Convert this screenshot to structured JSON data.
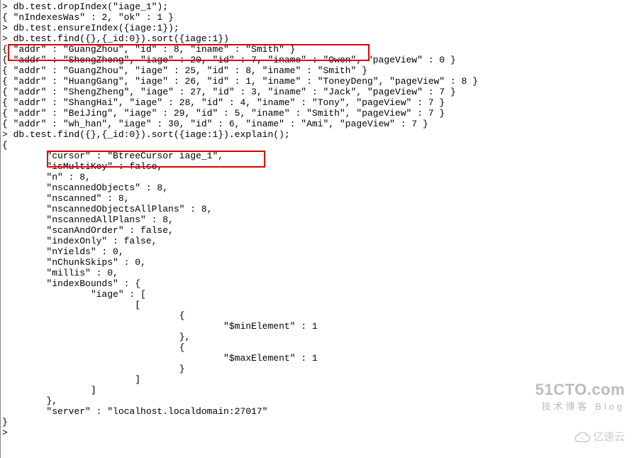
{
  "lines": {
    "l1": "> db.test.dropIndex(\"iage_1\");",
    "l2": "{ \"nIndexesWas\" : 2, \"ok\" : 1 }",
    "l3": "> db.test.ensureIndex({iage:1});",
    "l4": "> db.test.find({},{_id:0}).sort({iage:1})",
    "l5": "{ \"addr\" : \"GuangZhou\", \"id\" : 8, \"iname\" : \"Smith\" }",
    "l6": "{ \"addr\" : \"ShengZheng\", \"iage\" : 20, \"id\" : 7, \"iname\" : \"Owen\", \"pageView\" : 0 }",
    "l7": "{ \"addr\" : \"GuangZhou\", \"iage\" : 25, \"id\" : 8, \"iname\" : \"Smith\" }",
    "l8": "{ \"addr\" : \"HuangGang\", \"iage\" : 26, \"id\" : 1, \"iname\" : \"ToneyDeng\", \"pageView\" : 8 }",
    "l9": "{ \"addr\" : \"ShengZheng\", \"iage\" : 27, \"id\" : 3, \"iname\" : \"Jack\", \"pageView\" : 7 }",
    "l10": "{ \"addr\" : \"ShangHai\", \"iage\" : 28, \"id\" : 4, \"iname\" : \"Tony\", \"pageView\" : 7 }",
    "l11": "{ \"addr\" : \"BeiJing\", \"iage\" : 29, \"id\" : 5, \"iname\" : \"Smith\", \"pageView\" : 7 }",
    "l12": "{ \"addr\" : \"wh_han\", \"iage\" : 30, \"id\" : 6, \"iname\" : \"Ami\", \"pageView\" : 7 }",
    "l13": "> db.test.find({},{_id:0}).sort({iage:1}).explain();",
    "l14": "{",
    "l15": "        \"cursor\" : \"BtreeCursor iage_1\",",
    "l16": "        \"isMultiKey\" : false,",
    "l17": "        \"n\" : 8,",
    "l18": "        \"nscannedObjects\" : 8,",
    "l19": "        \"nscanned\" : 8,",
    "l20": "        \"nscannedObjectsAllPlans\" : 8,",
    "l21": "        \"nscannedAllPlans\" : 8,",
    "l22": "        \"scanAndOrder\" : false,",
    "l23": "        \"indexOnly\" : false,",
    "l24": "        \"nYields\" : 0,",
    "l25": "        \"nChunkSkips\" : 0,",
    "l26": "        \"millis\" : 0,",
    "l27": "        \"indexBounds\" : {",
    "l28": "                \"iage\" : [",
    "l29": "                        [",
    "l30": "                                {",
    "l31": "                                        \"$minElement\" : 1",
    "l32": "                                },",
    "l33": "                                {",
    "l34": "                                        \"$maxElement\" : 1",
    "l35": "                                }",
    "l36": "                        ]",
    "l37": "                ]",
    "l38": "        },",
    "l39": "        \"server\" : \"localhost.localdomain:27017\"",
    "l40": "}",
    "l41": ">"
  },
  "watermark": {
    "big": "51CTO.com",
    "small": "技术博客  Blog",
    "second": "亿速云"
  }
}
